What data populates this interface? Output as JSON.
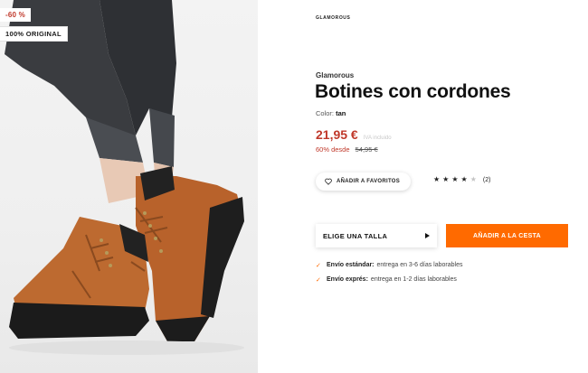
{
  "badges": {
    "discount": "-60 %",
    "original": "100% ORIGINAL"
  },
  "header": {
    "brand_logo": "GLAMOROUS"
  },
  "product": {
    "brand": "Glamorous",
    "title": "Botines con cordones",
    "color_label": "Color:",
    "color_value": "tan",
    "price": "21,95 €",
    "vat_note": "IVA incluido",
    "discount_text": "60% desde",
    "old_price": "54,95 €"
  },
  "actions": {
    "favorite_label": "AÑADIR A FAVORITOS",
    "size_label": "ELIGE UNA TALLA",
    "cart_label": "AÑADIR A LA CESTA"
  },
  "rating": {
    "stars": 4,
    "max_stars": 5,
    "count_text": "(2)"
  },
  "shipping": [
    {
      "label": "Envío estándar:",
      "text": "entrega en 3-6 días laborables"
    },
    {
      "label": "Envío exprés:",
      "text": "entrega en 1-2 días laborables"
    }
  ],
  "colors": {
    "accent": "#ff6a00",
    "price": "#c0392b"
  }
}
